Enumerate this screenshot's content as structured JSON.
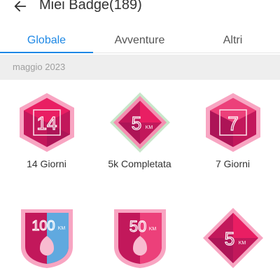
{
  "header": {
    "title": "Miei Badge(189)",
    "back_icon": "arrow-left-icon"
  },
  "tabs": [
    {
      "label": "Globale",
      "active": true
    },
    {
      "label": "Avventure",
      "active": false
    },
    {
      "label": "Altri",
      "active": false
    }
  ],
  "section": {
    "date": "maggio 2023"
  },
  "badges_row1": [
    {
      "label": "14 Giorni",
      "icon_text": "14",
      "shape": "hexagon"
    },
    {
      "label": "5k Completata",
      "icon_text": "5",
      "icon_unit": "KM",
      "shape": "diamond"
    },
    {
      "label": "7 Giorni",
      "icon_text": "7",
      "shape": "hexagon"
    }
  ],
  "badges_row2": [
    {
      "icon_text": "100",
      "icon_unit": "KM",
      "shape": "shield"
    },
    {
      "icon_text": "50",
      "icon_unit": "KM",
      "shape": "shield"
    },
    {
      "icon_text": "5",
      "icon_unit": "KM",
      "shape": "diamond"
    }
  ],
  "colors": {
    "accent": "#1e88e5",
    "badge_pink": "#f06292",
    "badge_magenta": "#c2185b",
    "badge_light": "#f8bbd0"
  }
}
